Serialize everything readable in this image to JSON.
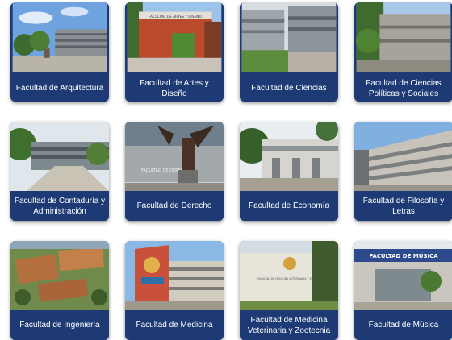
{
  "faculties": [
    {
      "name": "Facultad de Arquitectura",
      "icon": "building-photo"
    },
    {
      "name": "Facultad de Artes y Diseño",
      "icon": "building-photo",
      "sign": "FACULTAD DE ARTES Y DISEÑO"
    },
    {
      "name": "Facultad de Ciencias",
      "icon": "building-photo"
    },
    {
      "name": "Facultad de Ciencias Políticas y Sociales",
      "icon": "building-photo"
    },
    {
      "name": "Facultad de Contaduría y Administración",
      "icon": "building-photo"
    },
    {
      "name": "Facultad de Derecho",
      "icon": "eagle-sculpture-photo",
      "sign": "FACULTAD DE DERECHO"
    },
    {
      "name": "Facultad de Economía",
      "icon": "building-photo"
    },
    {
      "name": "Facultad de Filosofía y Letras",
      "icon": "building-photo"
    },
    {
      "name": "Facultad de Ingeniería",
      "icon": "aerial-campus-photo"
    },
    {
      "name": "Facultad de Medicina",
      "icon": "mural-building-photo"
    },
    {
      "name": "Facultad de Medicina Veterinaria y Zootecnia",
      "icon": "building-photo",
      "sign": "FACULTAD DE MEDICINA VETERINARIA Y ZOOTECNIA"
    },
    {
      "name": "Facultad de Música",
      "icon": "building-photo",
      "sign": "FACULTAD DE MÚSICA"
    }
  ],
  "colors": {
    "caption_bg": "#1d3a74",
    "caption_text": "#ffffff"
  }
}
